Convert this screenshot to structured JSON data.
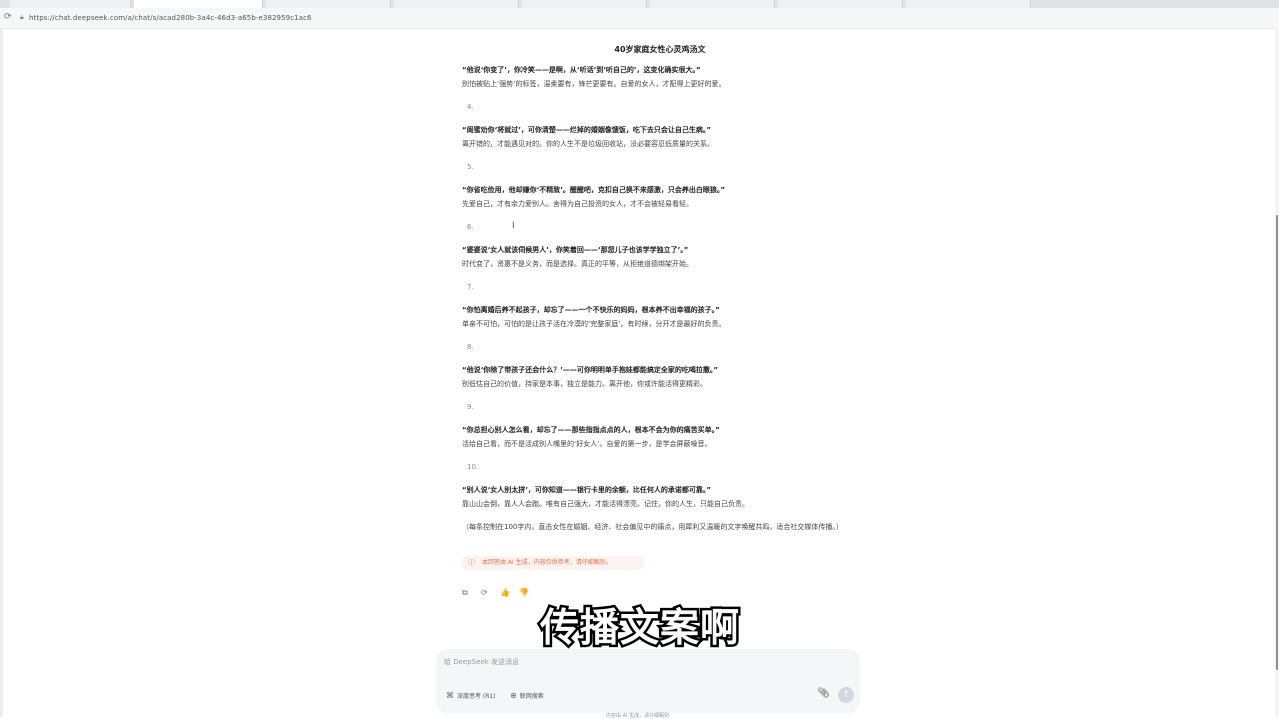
{
  "browser": {
    "url": "https://chat.deepseek.com/a/chat/s/acad280b-3a4c-46d3-a65b-e382959c1ac6",
    "reload_icon": "reload-icon",
    "lock_icon": "lock-icon"
  },
  "article": {
    "title": "40岁家庭女性心灵鸡汤文",
    "top_quote": "“他说‘你变了’，你冷笑——是啊，从‘听话’到‘听自己的’，这变化确实很大。”",
    "top_body": "别怕被贴上‘强势’的标签，温柔要有，锋芒更要有。自爱的女人，才配得上更好的爱。",
    "items": [
      {
        "num": "4.",
        "quote": "“闺蜜劝你‘将就过’，可你清楚——烂掉的婚姻像馊饭，吃下去只会让自己生病。”",
        "body": "离开错的，才能遇见对的。你的人生不是垃圾回收站，没必要容忍低质量的关系。"
      },
      {
        "num": "5.",
        "quote": "“你省吃俭用，他却嫌你‘不精致’。醒醒吧，克扣自己换不来感激，只会养出白眼狼。”",
        "body": "先爱自己，才有余力爱别人。舍得为自己投资的女人，才不会被轻易看轻。"
      },
      {
        "num": "6.",
        "quote": "“婆婆说‘女人就该伺候男人’，你笑着回——‘那您儿子也该学学独立了’。”",
        "body": "时代变了，贤惠不是义务，而是选择。真正的平等，从拒绝道德绑架开始。"
      },
      {
        "num": "7.",
        "quote": "“你怕离婚后养不起孩子，却忘了——一个不快乐的妈妈，根本养不出幸福的孩子。”",
        "body": "单亲不可怕，可怕的是让孩子活在冷漠的‘完整家庭’。有时候，分开才是最好的负责。"
      },
      {
        "num": "8.",
        "quote": "“他说‘你除了带孩子还会什么？’——可你明明单手抱娃都能搞定全家的吃喝拉撒。”",
        "body": "别低估自己的价值，持家是本事，独立是能力。离开他，你或许能活得更精彩。"
      },
      {
        "num": "9.",
        "quote": "“你总担心别人怎么看，却忘了——那些指指点点的人，根本不会为你的痛苦买单。”",
        "body": "活给自己看，而不是活成别人嘴里的‘好女人’。自爱的第一步，是学会屏蔽噪音。"
      },
      {
        "num": "10.",
        "quote": "“别人说‘女人别太拼’，可你知道——银行卡里的余额，比任何人的承诺都可靠。”",
        "body": "靠山山会倒，靠人人会跑。唯有自己强大，才能活得漂亮。记住，你的人生，只能自己负责。"
      }
    ],
    "note": "（每条控制在100字内，直击女性在婚姻、经济、社会偏见中的痛点，用犀利又温暖的文字唤醒共鸣，适合社交媒体传播。）"
  },
  "disclaimer": {
    "icon": "info-icon",
    "text": "本回答由 AI 生成，内容仅供参考，请仔细甄别。"
  },
  "actions": [
    {
      "name": "copy-button",
      "icon": "copy-icon",
      "glyph": "⧉"
    },
    {
      "name": "regenerate-button",
      "icon": "refresh-icon",
      "glyph": "⟳"
    },
    {
      "name": "like-button",
      "icon": "thumbs-up-icon",
      "glyph": "👍"
    },
    {
      "name": "dislike-button",
      "icon": "thumbs-down-icon",
      "glyph": "👎"
    }
  ],
  "video_subtitle": "传播文案啊",
  "composer": {
    "placeholder": "给 DeepSeek 发送消息",
    "deep_think_label": "深度思考 (R1)",
    "web_search_label": "联网搜索",
    "attach_icon": "paperclip-icon",
    "send_icon": "arrow-up-icon"
  },
  "footer_text": "内容由 AI 生成，请仔细甄别"
}
